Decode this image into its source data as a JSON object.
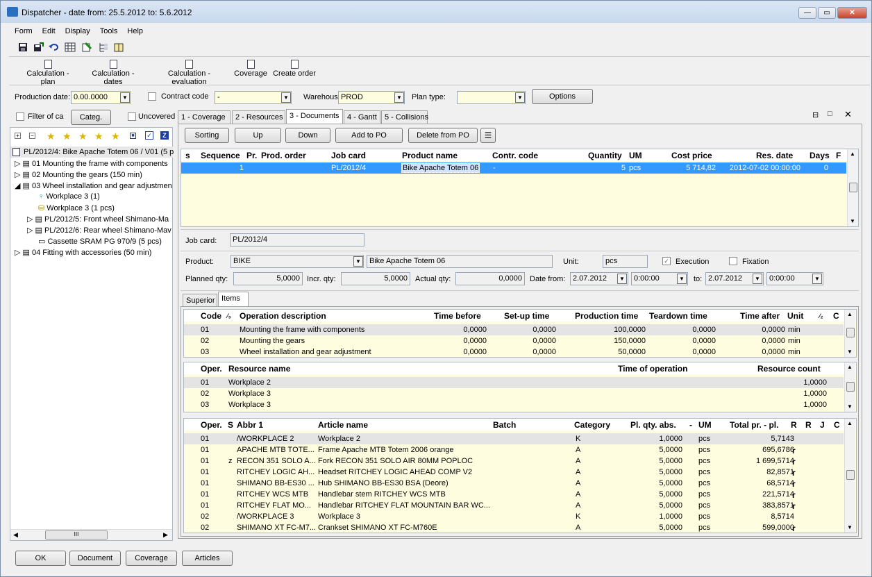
{
  "window": {
    "title": "Dispatcher - date from: 25.5.2012 to: 5.6.2012"
  },
  "menu": [
    "Form",
    "Edit",
    "Display",
    "Tools",
    "Help"
  ],
  "toolbar_icons": [
    "save-icon",
    "save-as-icon",
    "undo-icon",
    "grid-icon",
    "export-icon",
    "tree-icon",
    "book-icon"
  ],
  "actions": [
    "Calculation - plan",
    "Calculation - dates",
    "Calculation - evaluation",
    "Coverage",
    "Create order"
  ],
  "filters": {
    "production_date_label": "Production date:",
    "production_date": "0.00.0000",
    "contract_code_label": "Contract code",
    "contract_code": "-",
    "warehouse_label": "Warehous",
    "warehouse": "PROD",
    "plan_type_label": "Plan type:",
    "plan_type": "",
    "options": "Options",
    "filter_ca": "Filter of ca",
    "categ": "Categ.",
    "uncovered": "Uncovered"
  },
  "tree": {
    "root": "PL/2012/4: Bike Apache Totem 06 / V01 (5 p",
    "items": [
      "01 Mounting the frame with components",
      "02 Mounting the gears (150 min)",
      "03 Wheel installation and gear adjustmen",
      "Workplace 3 (1)",
      "Workplace 3 (1 pcs)",
      "PL/2012/5: Front wheel Shimano-Ma",
      "PL/2012/6: Rear wheel Shimano-Mav",
      "Cassette SRAM PG 970/9 (5 pcs)",
      "04 Fitting with accessories (50 min)"
    ],
    "scroll_label": "III"
  },
  "tabs": [
    "1 - Coverage",
    "2 - Resources",
    "3 - Documents",
    "4 - Gantt",
    "5 - Collisions"
  ],
  "doc_toolbar": [
    "Sorting",
    "Up",
    "Down",
    "Add to PO",
    "Delete from PO"
  ],
  "docs_grid": {
    "headers": [
      "s",
      "Sequence",
      "Pr.",
      "Prod. order",
      "Job card",
      "Product name",
      "Contr. code",
      "Quantity",
      "UM",
      "Cost price",
      "Res. date",
      "Days",
      "F"
    ],
    "rows": [
      {
        "seq": "1",
        "pr": "",
        "po": "",
        "job": "PL/2012/4",
        "product": "Bike Apache Totem 06",
        "contr": "-",
        "qty": "5",
        "um": "pcs",
        "cost": "5 714,82",
        "res": "2012-07-02 00:00:00",
        "days": "0"
      }
    ]
  },
  "detail": {
    "job_card_label": "Job card:",
    "job_card": "PL/2012/4",
    "product_label": "Product:",
    "product": "BIKE",
    "product_name": "Bike Apache Totem 06",
    "unit_label": "Unit:",
    "unit": "pcs",
    "execution": "Execution",
    "fixation": "Fixation",
    "planned_label": "Planned qty:",
    "planned": "5,0000",
    "incr_label": "Incr. qty:",
    "incr": "5,0000",
    "actual_label": "Actual qty:",
    "actual": "0,0000",
    "date_from_label": "Date from:",
    "date_from": "2.07.2012",
    "time_from": "0:00:00",
    "to_label": "to:",
    "date_to": "2.07.2012",
    "time_to": "0:00:00"
  },
  "subtabs": [
    "Superior",
    "Items"
  ],
  "ops_grid": {
    "headers": [
      "Code",
      "⁄₃",
      "Operation description",
      "Time before",
      "Set-up time",
      "Production time",
      "Teardown time",
      "Time after",
      "Unit",
      "⁄₂",
      "C"
    ],
    "rows": [
      [
        "01",
        "Mounting the frame with components",
        "0,0000",
        "0,0000",
        "100,0000",
        "0,0000",
        "0,0000",
        "min"
      ],
      [
        "02",
        "Mounting the gears",
        "0,0000",
        "0,0000",
        "150,0000",
        "0,0000",
        "0,0000",
        "min"
      ],
      [
        "03",
        "Wheel installation and gear adjustment",
        "0,0000",
        "0,0000",
        "50,0000",
        "0,0000",
        "0,0000",
        "min"
      ]
    ]
  },
  "res_grid": {
    "headers": [
      "Oper.",
      "Resource name",
      "Time of operation",
      "Resource count"
    ],
    "rows": [
      [
        "01",
        "Workplace 2",
        "",
        "1,0000"
      ],
      [
        "02",
        "Workplace 3",
        "",
        "1,0000"
      ],
      [
        "03",
        "Workplace 3",
        "",
        "1,0000"
      ]
    ]
  },
  "art_grid": {
    "headers": [
      "Oper.",
      "S",
      "Abbr 1",
      "Article name",
      "Batch",
      "Category",
      "Pl. qty. abs.",
      "-",
      "UM",
      "Total pr. - pl.",
      "R",
      "R",
      "J",
      "C"
    ],
    "rows": [
      [
        "01",
        "",
        "/WORKPLACE 2",
        "Workplace 2",
        "",
        "K",
        "1,0000",
        "pcs",
        "5,7143",
        ""
      ],
      [
        "01",
        "",
        "APACHE MTB TOTE...",
        "Frame Apache MTB Totem 2006 orange",
        "",
        "A",
        "5,0000",
        "pcs",
        "695,6786",
        "r"
      ],
      [
        "01",
        "z",
        "RECON 351 SOLO A...",
        "Fork RECON 351 SOLO AIR 80MM POPLOC",
        "",
        "A",
        "5,0000",
        "pcs",
        "1 699,5714",
        "r"
      ],
      [
        "01",
        "",
        "RITCHEY LOGIC AH...",
        "Headset RITCHEY LOGIC AHEAD COMP V2",
        "",
        "A",
        "5,0000",
        "pcs",
        "82,8571",
        "r"
      ],
      [
        "01",
        "",
        "SHIMANO BB-ES30 ...",
        "Hub SHIMANO BB-ES30 BSA (Deore)",
        "",
        "A",
        "5,0000",
        "pcs",
        "68,5714",
        "r"
      ],
      [
        "01",
        "",
        "RITCHEY WCS MTB",
        "Handlebar stem RITCHEY WCS MTB",
        "",
        "A",
        "5,0000",
        "pcs",
        "221,5714",
        "r"
      ],
      [
        "01",
        "",
        "RITCHEY FLAT MO...",
        "Handlebar RITCHEY FLAT MOUNTAIN BAR WC...",
        "",
        "A",
        "5,0000",
        "pcs",
        "383,8571",
        "r"
      ],
      [
        "02",
        "",
        "/WORKPLACE 3",
        "Workplace 3",
        "",
        "K",
        "1,0000",
        "pcs",
        "8,5714",
        ""
      ],
      [
        "02",
        "",
        "SHIMANO XT FC-M7...",
        "Crankset SHIMANO XT FC-M760E",
        "",
        "A",
        "5,0000",
        "pcs",
        "599,0000",
        "r"
      ]
    ]
  },
  "bottom_buttons": [
    "OK",
    "Document",
    "Coverage",
    "Articles"
  ],
  "colors": {
    "selection": "#3399ff",
    "grid_bg": "#fffde0"
  }
}
